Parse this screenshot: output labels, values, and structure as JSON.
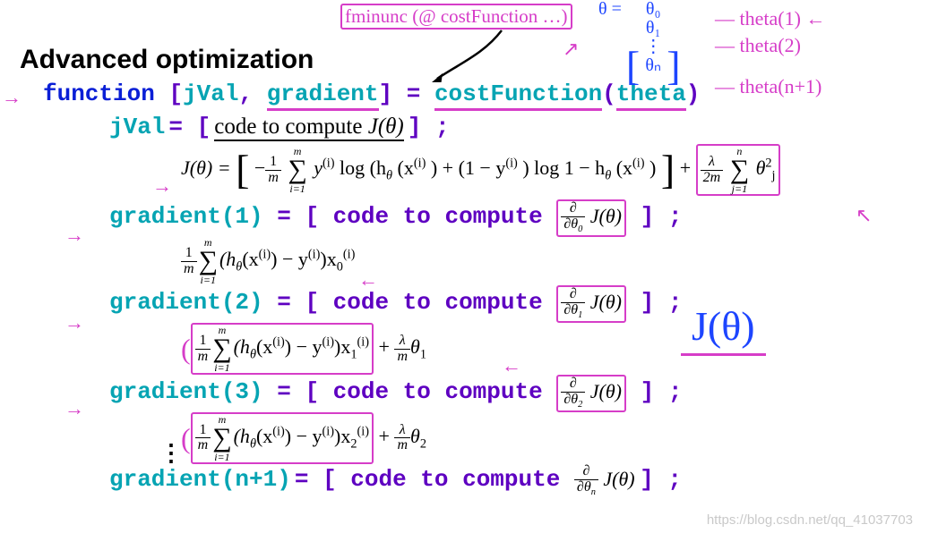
{
  "title": "Advanced optimization",
  "sig": {
    "func_kw": "function",
    "lbr": "[",
    "out1": "jVal",
    "comma": ", ",
    "out2": "gradient",
    "rbr": "]",
    "eq": " = ",
    "name": "costFunction",
    "paren_open": "(",
    "arg": "theta",
    "paren_close": ")"
  },
  "jval_line": {
    "lhs": "jVal",
    "eq": " = ",
    "open": "[",
    "txt": " code to compute ",
    "sym": "J(θ)",
    "close": "] ;"
  },
  "jtheta_eq": {
    "lhs": "J(θ) =",
    "neg_frac_n": "1",
    "neg_frac_d": "m",
    "sum_top": "m",
    "sum_bot": "i=1",
    "body1": " y",
    "body2": " log (h",
    "body3": "(x",
    "body4": ") + (1 − y",
    "body5": ") log 1 − h",
    "body6": "(x",
    "body7": ")",
    "plus": " +",
    "reg_frac_n": "λ",
    "reg_frac_d": "2m",
    "reg_sum_top": "n",
    "reg_sum_bot": "j=1",
    "reg_body": " θ",
    "reg_sub": "j",
    "reg_sup": "2"
  },
  "grad": {
    "code_prefix": "[ code to compute ",
    "code_suffix": " ] ;",
    "lines": [
      {
        "label": "gradient(1)",
        "dtheta_sub": "0",
        "x_sub": "0",
        "has_reg": false,
        "reg_sub": ""
      },
      {
        "label": "gradient(2)",
        "dtheta_sub": "1",
        "x_sub": "1",
        "has_reg": true,
        "reg_sub": "1"
      },
      {
        "label": "gradient(3)",
        "dtheta_sub": "2",
        "x_sub": "2",
        "has_reg": true,
        "reg_sub": "2"
      }
    ],
    "common": {
      "frac_n": "1",
      "frac_d": "m",
      "sum_top": "m",
      "sum_bot": "i=1",
      "inside1": "(h",
      "inside2": "(x",
      "inside3": ") − y",
      "inside4": ")x",
      "lambda_frac_n": "λ",
      "lambda_frac_d": "m",
      "lambda_theta": "θ"
    },
    "final": {
      "label": "gradient(n+1)",
      "dtheta_sub": "n"
    }
  },
  "annotations": {
    "fminunc": "fminunc (@ costFunction …)",
    "theta_vec": "θ =",
    "vec_rows": [
      "θ₀",
      "θ₁",
      "⋮",
      "θₙ"
    ],
    "theta_labels": [
      "theta(1)",
      "theta(2)",
      "theta(n+1)"
    ],
    "big_j": "J(θ)"
  },
  "watermark": "https://blog.csdn.net/qq_41037703"
}
